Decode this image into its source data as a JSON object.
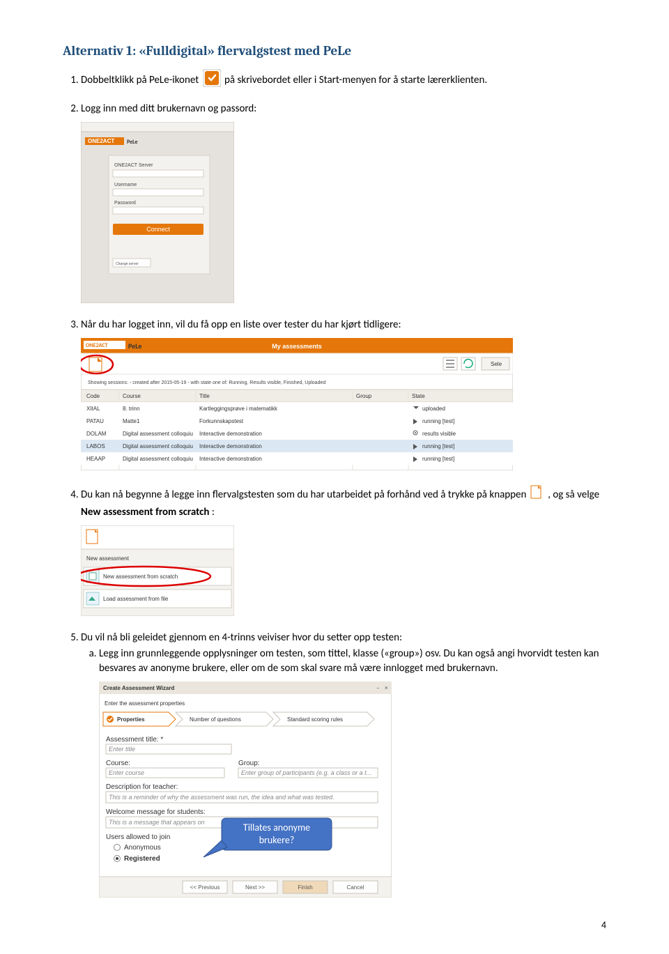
{
  "title": "Alternativ 1: «Fulldigital» flervalgstest med PeLe",
  "steps": {
    "s1a": "Dobbeltklikk på PeLe-ikonet ",
    "s1b": " på skrivebordet eller i Start-menyen for å starte lærerklienten.",
    "s2": "Logg inn med ditt brukernavn og passord:",
    "s3": "Når du har logget inn, vil du få opp en liste over tester du har kjørt tidligere:",
    "s4a": "Du kan nå begynne å legge inn flervalgstesten som du har utarbeidet på forhånd ved å trykke på knappen ",
    "s4b": ", og så velge ",
    "s4c": "New assessment from scratch",
    "s4d": ":",
    "s5": "Du vil nå bli geleidet gjennom en 4-trinns veiviser hvor du setter opp testen:",
    "s5a": "Legg inn grunnleggende opplysninger om testen, som tittel, klasse («group») osv. Du kan også angi hvorvidt testen kan besvares av anonyme brukere, eller om de som skal svare må være innlogget med brukernavn."
  },
  "fig_login": {
    "brand": "ONE2ACT",
    "app": "PeLe",
    "connect": "Connect",
    "username": "Username",
    "password": "Password",
    "server": "ONE2ACT Server",
    "change": "Change server"
  },
  "fig_assess": {
    "brand": "ONE2ACT",
    "app": "PeLe",
    "header": "My assessments",
    "sele": "Sele",
    "filterline": "Showing sessions: - created after 2015-05-19 - with state one of: Running, Results visible, Finished, Uploaded",
    "cols": [
      "Code",
      "Course",
      "Title",
      "Group",
      "State"
    ],
    "rows": [
      [
        "XIIAL",
        "8. trinn",
        "Kartleggingsprøve i matematikk",
        "",
        "uploaded"
      ],
      [
        "PATAU",
        "Matte1",
        "Forkunnskapstest",
        "",
        "running  [test]"
      ],
      [
        "DOLAM",
        "Digital assessment colloquiu",
        "Interactive demonstration",
        "",
        "results visible"
      ],
      [
        "LABOS",
        "Digital assessment colloquiu",
        "Interactive demonstration",
        "",
        "running  [test]"
      ],
      [
        "HEAAP",
        "Digital assessment colloquiu",
        "Interactive demonstration",
        "",
        "running  [test]"
      ]
    ]
  },
  "fig_menu": {
    "new": "New assessment",
    "scratch": "New assessment from scratch",
    "load": "Load assessment from file"
  },
  "fig_wizard": {
    "title": "Create Assessment Wizard",
    "intro": "Enter the assessment properties",
    "tabs": [
      "Properties",
      "Number of questions",
      "Standard scoring rules"
    ],
    "fields": {
      "asstitle": "Assessment title: *",
      "asstitle_ph": "Enter title",
      "course": "Course:",
      "course_ph": "Enter course",
      "group": "Group:",
      "group_ph": "Enter group of participants (e.g. a class or a t...",
      "desc": "Description for teacher:",
      "desc_ph": "This is a reminder of why the assessment was run, the idea and what was tested.",
      "welcome": "Welcome message for students:",
      "welcome_ph": "This is a message that appears on",
      "allowed": "Users allowed to join",
      "anon": "Anonymous",
      "reg": "Registered"
    },
    "buttons": {
      "prev": "<< Previous",
      "next": "Next >>",
      "finish": "Finish",
      "cancel": "Cancel"
    }
  },
  "callout": "Tillates anonyme brukere?",
  "page_number": "4"
}
